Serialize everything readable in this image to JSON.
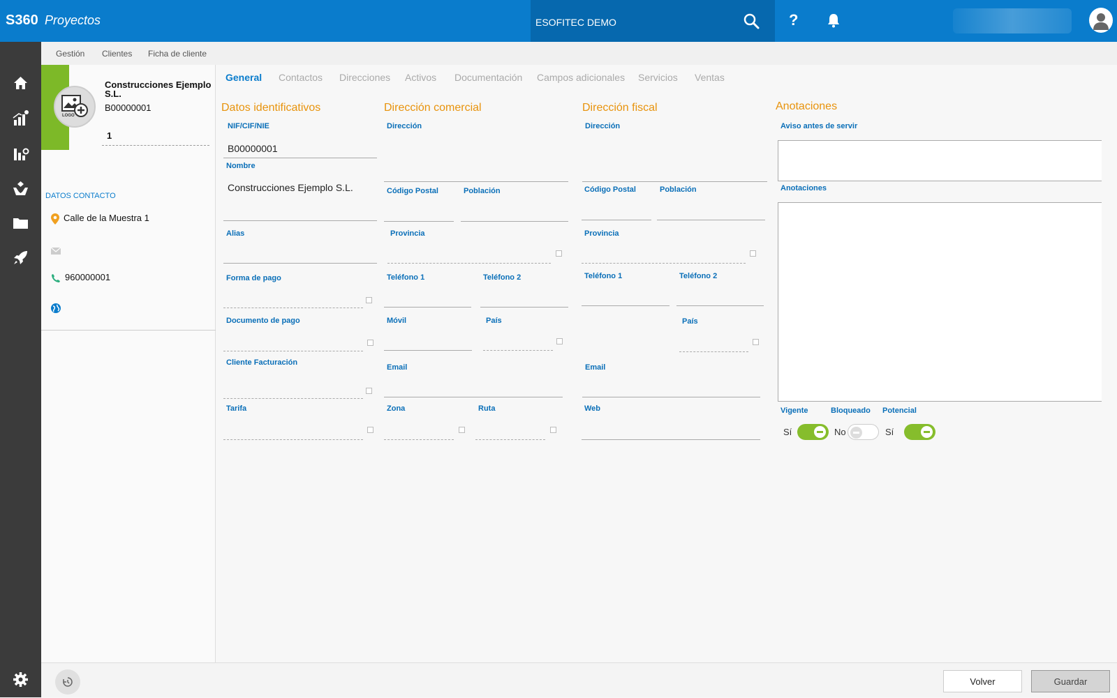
{
  "header": {
    "brand": "S360",
    "app_name": "Proyectos",
    "company": "ESOFITEC DEMO"
  },
  "breadcrumb": [
    "Gestión",
    "Clientes",
    "Ficha de cliente"
  ],
  "client": {
    "name": "Construcciones Ejemplo S.L.",
    "code": "B00000001",
    "number": "1",
    "logo_text": "LOGO"
  },
  "contact": {
    "heading": "DATOS CONTACTO",
    "address": "Calle de la Muestra 1",
    "email": "",
    "phone": "960000001",
    "web": ""
  },
  "tabs": [
    "General",
    "Contactos",
    "Direcciones",
    "Activos",
    "Documentación",
    "Campos adicionales",
    "Servicios",
    "Ventas"
  ],
  "sections": {
    "ident": {
      "title": "Datos identificativos",
      "nif_label": "NIF/CIF/NIE",
      "nif_value": "B00000001",
      "nombre_label": "Nombre",
      "nombre_value": "Construcciones Ejemplo S.L.",
      "alias_label": "Alias",
      "forma_pago_label": "Forma de pago",
      "doc_pago_label": "Documento de pago",
      "cliente_fact_label": "Cliente Facturación",
      "tarifa_label": "Tarifa"
    },
    "comercial": {
      "title": "Dirección comercial",
      "direccion_label": "Dirección",
      "cp_label": "Código Postal",
      "poblacion_label": "Población",
      "provincia_label": "Provincia",
      "tel1_label": "Teléfono 1",
      "tel2_label": "Teléfono 2",
      "movil_label": "Móvil",
      "pais_label": "País",
      "email_label": "Email",
      "zona_label": "Zona",
      "ruta_label": "Ruta"
    },
    "fiscal": {
      "title": "Dirección fiscal",
      "direccion_label": "Dirección",
      "cp_label": "Código Postal",
      "poblacion_label": "Población",
      "provincia_label": "Provincia",
      "tel1_label": "Teléfono 1",
      "tel2_label": "Teléfono 2",
      "pais_label": "País",
      "email_label": "Email",
      "web_label": "Web"
    },
    "anotaciones": {
      "title": "Anotaciones",
      "aviso_label": "Aviso antes de servir",
      "anotaciones_label": "Anotaciones",
      "vigente_label": "Vigente",
      "bloqueado_label": "Bloqueado",
      "potencial_label": "Potencial",
      "vigente_value": "Sí",
      "bloqueado_value": "No",
      "potencial_value": "Sí"
    }
  },
  "footer": {
    "volver": "Volver",
    "guardar": "Guardar"
  },
  "colors": {
    "primary": "#0a7ccc",
    "section_title": "#e8930c",
    "accent_green": "#7db928",
    "sidebar": "#3b3b3b"
  }
}
